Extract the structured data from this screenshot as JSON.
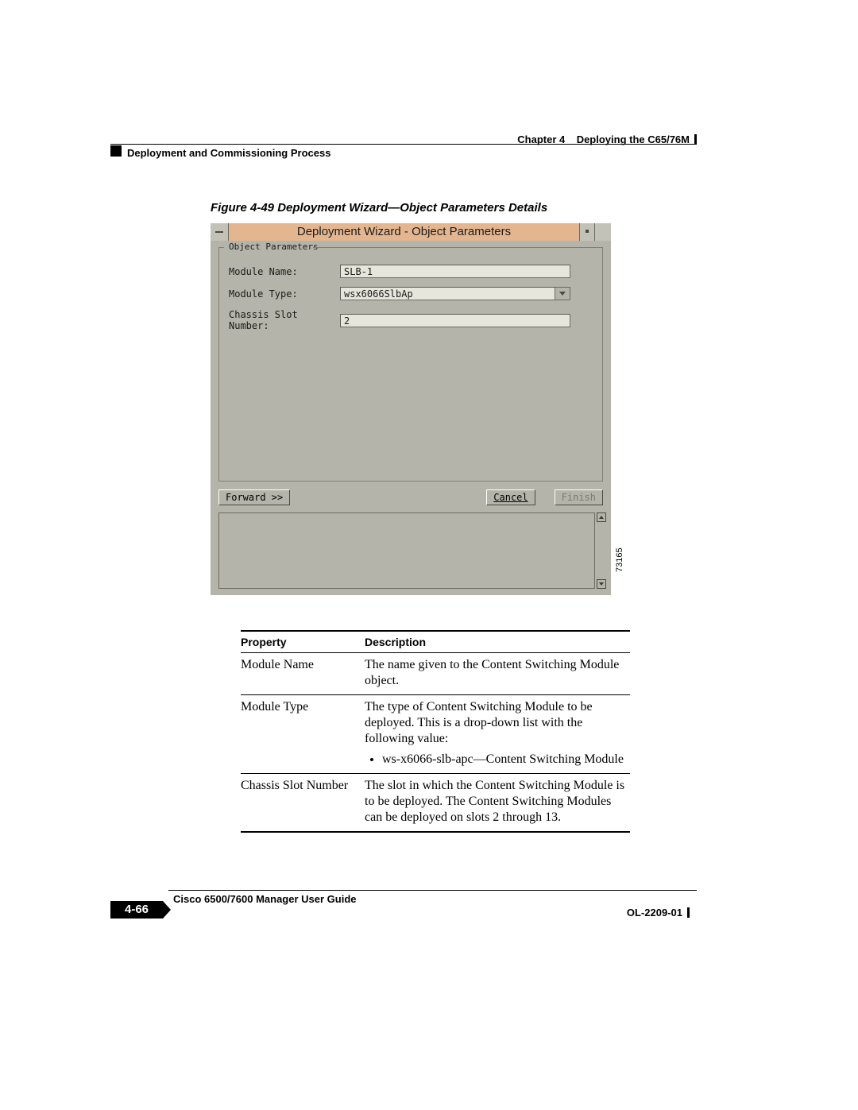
{
  "header": {
    "chapter_label": "Chapter 4",
    "chapter_title": "Deploying the C65/76M",
    "section": "Deployment and Commissioning Process"
  },
  "figure": {
    "caption": "Figure 4-49   Deployment Wizard—Object Parameters Details",
    "image_id": "73165"
  },
  "dialog": {
    "title": "Deployment Wizard - Object Parameters",
    "group_label": "Object Parameters",
    "fields": {
      "module_name": {
        "label": "Module Name:",
        "value": "SLB-1"
      },
      "module_type": {
        "label": "Module Type:",
        "value": "wsx6066SlbAp"
      },
      "chassis_slot": {
        "label": "Chassis Slot Number:",
        "value": "2"
      }
    },
    "buttons": {
      "forward": "Forward >>",
      "cancel": "Cancel",
      "finish": "Finish"
    }
  },
  "table": {
    "headers": {
      "property": "Property",
      "description": "Description"
    },
    "rows": [
      {
        "property": "Module Name",
        "description": "The name given to the Content Switching Module object."
      },
      {
        "property": "Module Type",
        "description": "The type of Content Switching Module to be deployed. This is a drop-down list with the following value:",
        "bullet": "ws-x6066-slb-apc—Content Switching Module"
      },
      {
        "property": "Chassis Slot Number",
        "description": "The slot in which the Content Switching Module is to be deployed. The Content Switching Modules can be deployed on slots 2 through 13."
      }
    ]
  },
  "footer": {
    "guide": "Cisco 6500/7600 Manager User Guide",
    "page": "4-66",
    "doc_id": "OL-2209-01"
  }
}
